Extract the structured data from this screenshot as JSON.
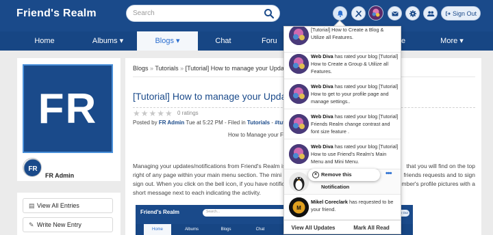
{
  "header": {
    "brand": "Friend's Realm",
    "search_placeholder": "Search",
    "signout_label": "Sign Out"
  },
  "nav": {
    "items": [
      "Home",
      "Albums",
      "Blogs",
      "Chat",
      "Foru",
      "More"
    ],
    "more_prefix": "e"
  },
  "sidebar": {
    "logo_text": "FR",
    "author_name": "FR Admin",
    "buttons": [
      "View All Entries",
      "Write New Entry"
    ]
  },
  "main": {
    "breadcrumb": [
      "Blogs",
      "Tutorials",
      "[Tutorial] How to manage your Updates/No"
    ],
    "title": "[Tutorial] How to manage your Updates/N",
    "ratings": "0 ratings",
    "meta": {
      "posted_by": "Posted by",
      "author": "FR Admin",
      "date": "Tue at 5:22 PM - Filed in",
      "category": "Tutorials",
      "tag": "#tutorial #u"
    },
    "subheading": "How to Manage your Fr",
    "body_lines": [
      "Managing your updates/notifications from Friend's Realm is qu",
      "right of any page within your main menu section.  The mini men",
      "sign out.  When you click on the bell icon, if you have notifications o",
      "short message next to each indicating the activity."
    ],
    "body_tail": [
      "that you will find on the top",
      "friends requests and to sign",
      "mber's profile pictures with a"
    ]
  },
  "embed": {
    "brand": "Friend's Realm",
    "search": "Search...",
    "signout": "Sign Out",
    "nav": [
      "Home",
      "Albums",
      "Blogs",
      "Chat"
    ]
  },
  "notifications": {
    "items": [
      {
        "actor": "",
        "text": "[Tutorial] How to Create a Blog & Utilize all Features."
      },
      {
        "actor": "Web Diva",
        "text": "has rated your blog [Tutorial] How to Create a Group & Utilize all Features."
      },
      {
        "actor": "Web Diva",
        "text": "has rated your blog [Tutorial] How to get to your profile page and manage settings.."
      },
      {
        "actor": "Web Diva",
        "text": "has rated your blog [Tutorial] Friends Realm change contrast and font size feature ."
      },
      {
        "actor": "Web Diva",
        "text": "has rated your blog [Tutorial] How to use Friend's Realm's Main Menu and Mini Menu."
      },
      {
        "actor": "Mikel Coreclark",
        "text": "has requested to be your friend."
      }
    ],
    "remove_label": "Remove this Notification",
    "more_label": "•••",
    "view_all": "View All Updates",
    "mark_read": "Mark All Read"
  },
  "colors": {
    "header_bg": "#1a4a8a",
    "nav_bg": "#174684",
    "accent": "#2a6ed0"
  }
}
